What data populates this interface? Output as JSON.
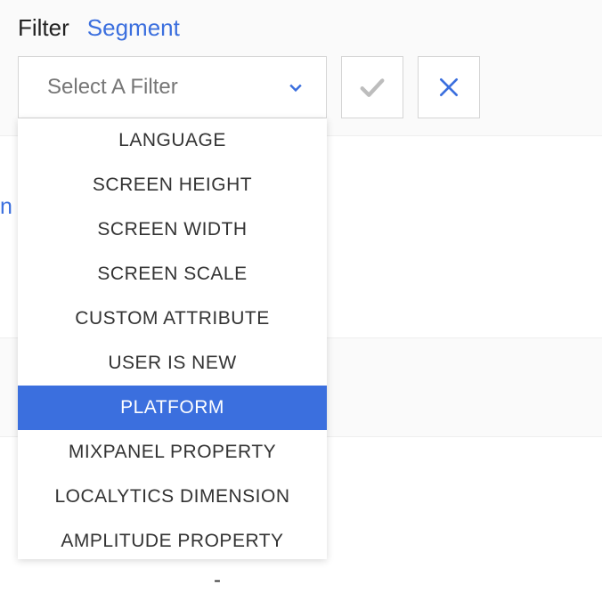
{
  "tabs": {
    "filter": "Filter",
    "segment": "Segment"
  },
  "select": {
    "placeholder": "Select A Filter"
  },
  "dropdown": {
    "items": [
      "LANGUAGE",
      "SCREEN HEIGHT",
      "SCREEN WIDTH",
      "SCREEN SCALE",
      "CUSTOM ATTRIBUTE",
      "USER IS NEW",
      "PLATFORM",
      "MIXPANEL PROPERTY",
      "LOCALYTICS DIMENSION",
      "AMPLITUDE PROPERTY"
    ],
    "selected_index": 6
  },
  "fragments": {
    "link": "n",
    "dash": "-"
  }
}
